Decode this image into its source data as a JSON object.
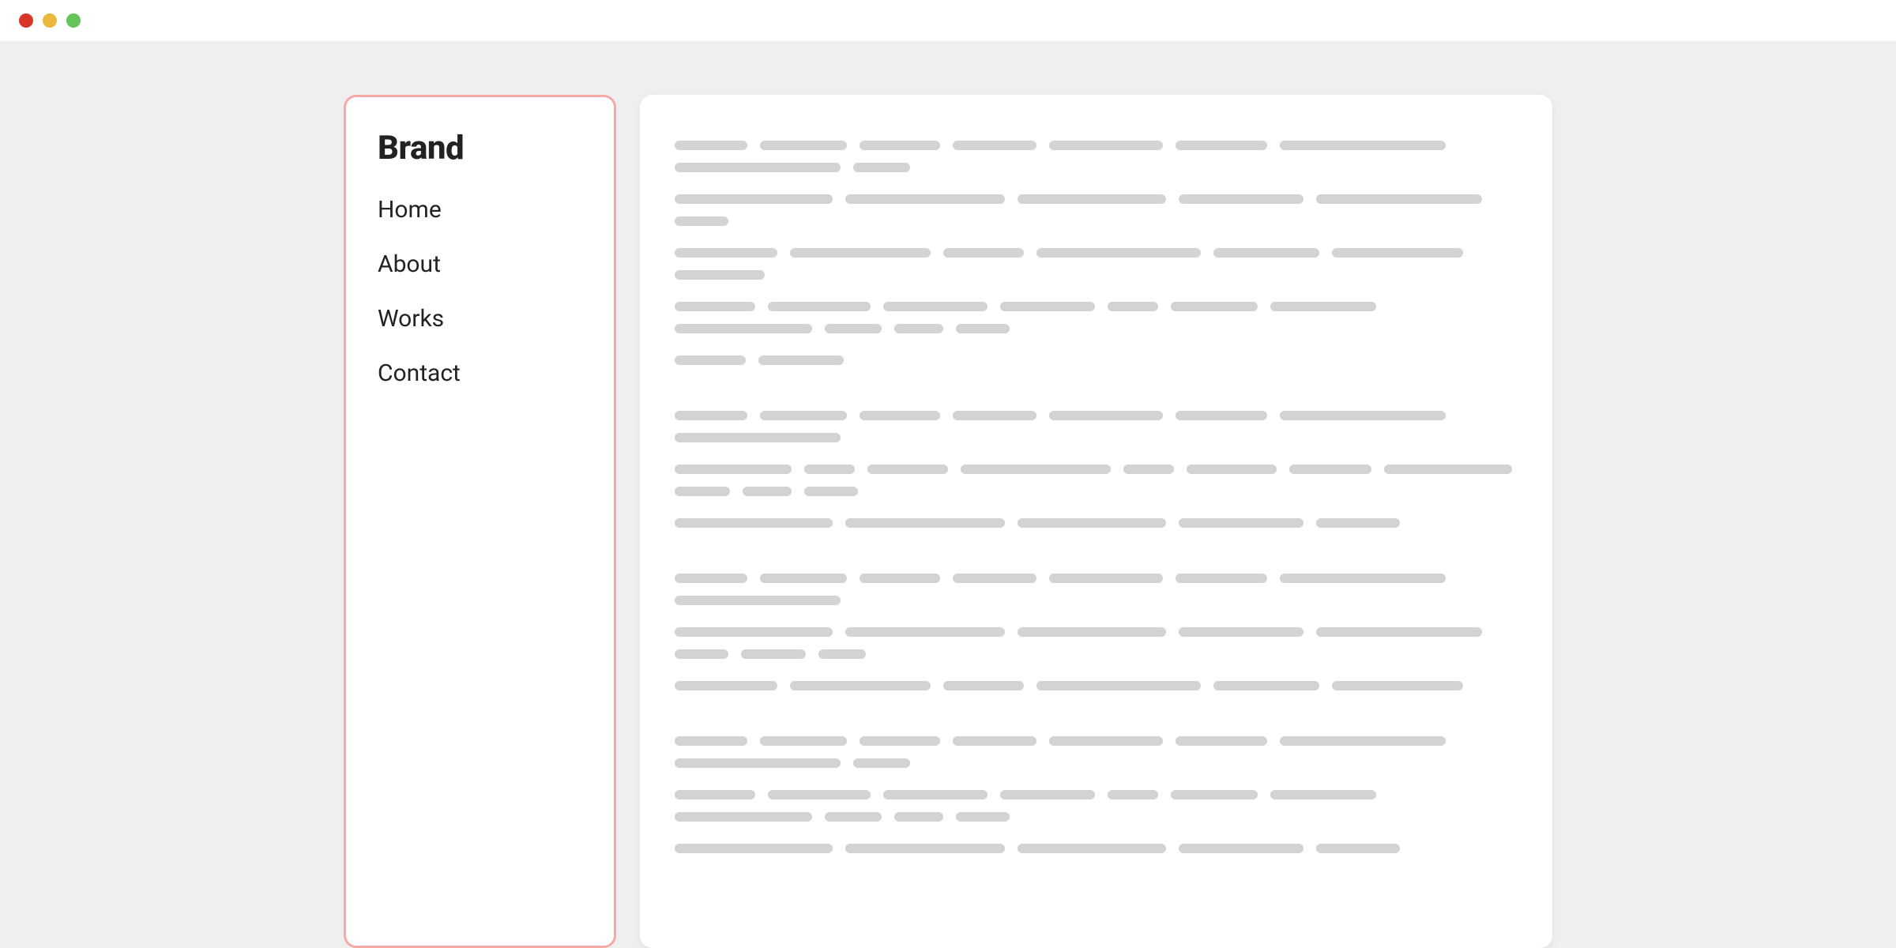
{
  "titlebar": {
    "buttons": [
      "close",
      "minimize",
      "zoom"
    ]
  },
  "sidebar": {
    "brand": "Brand",
    "nav": [
      {
        "label": "Home"
      },
      {
        "label": "About"
      },
      {
        "label": "Works"
      },
      {
        "label": "Contact"
      }
    ],
    "border_color": "#f7a9a6"
  },
  "main": {
    "placeholder_paragraphs": [
      {
        "lines": [
          [
            92,
            110,
            102,
            106,
            144,
            116,
            210,
            210,
            72
          ],
          [
            200,
            202,
            188,
            158,
            210,
            68
          ],
          [
            130,
            178,
            102,
            208,
            134,
            166,
            114
          ],
          [
            102,
            130,
            132,
            120,
            64,
            110,
            134,
            174,
            72,
            62,
            68
          ],
          [
            90,
            108
          ]
        ]
      },
      {
        "lines": [
          [
            92,
            110,
            102,
            106,
            144,
            116,
            210,
            210
          ],
          [
            148,
            64,
            102,
            190,
            64,
            114,
            104,
            162,
            70,
            62,
            68
          ],
          [
            200,
            202,
            188,
            158,
            106
          ]
        ]
      },
      {
        "lines": [
          [
            92,
            110,
            102,
            106,
            144,
            116,
            210,
            210
          ],
          [
            200,
            202,
            188,
            158,
            210,
            68,
            82,
            60
          ],
          [
            130,
            178,
            102,
            208,
            134,
            166
          ]
        ]
      },
      {
        "lines": [
          [
            92,
            110,
            102,
            106,
            144,
            116,
            210,
            210,
            72
          ],
          [
            102,
            130,
            132,
            120,
            64,
            110,
            134,
            174,
            72,
            62,
            68
          ],
          [
            200,
            202,
            188,
            158,
            106
          ]
        ]
      }
    ],
    "bar_color": "#d3d3d3"
  }
}
